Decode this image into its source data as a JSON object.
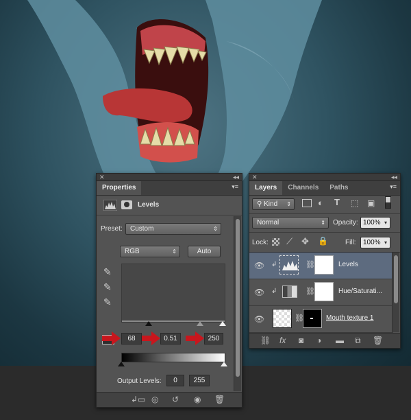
{
  "properties_panel": {
    "tab_label": "Properties",
    "adjustment_title": "Levels",
    "preset_label": "Preset:",
    "preset_value": "Custom",
    "channel_value": "RGB",
    "auto_button": "Auto",
    "input_shadow": "68",
    "input_midtone": "0.51",
    "input_highlight": "250",
    "output_levels_label": "Output Levels:",
    "output_black": "0",
    "output_white": "255"
  },
  "layers_panel": {
    "tabs": [
      "Layers",
      "Channels",
      "Paths"
    ],
    "filter_kind": "Kind",
    "blend_mode": "Normal",
    "opacity_label": "Opacity:",
    "opacity_value": "100%",
    "lock_label": "Lock:",
    "fill_label": "Fill:",
    "fill_value": "100%",
    "layers": [
      {
        "name": "Levels"
      },
      {
        "name": "Hue/Saturati..."
      },
      {
        "name": "Mouth texture 1"
      }
    ]
  },
  "colors": {
    "selected_layer": "#5d6b7f",
    "annotation_arrow": "#c8161d",
    "panel_bg": "#535353"
  },
  "icons": [
    "close-icon",
    "collapse-icon",
    "histogram-icon",
    "eyedropper-icon",
    "eye-icon",
    "link-icon",
    "trash-icon",
    "fx-icon",
    "folder-icon",
    "new-layer-icon",
    "mask-icon"
  ]
}
